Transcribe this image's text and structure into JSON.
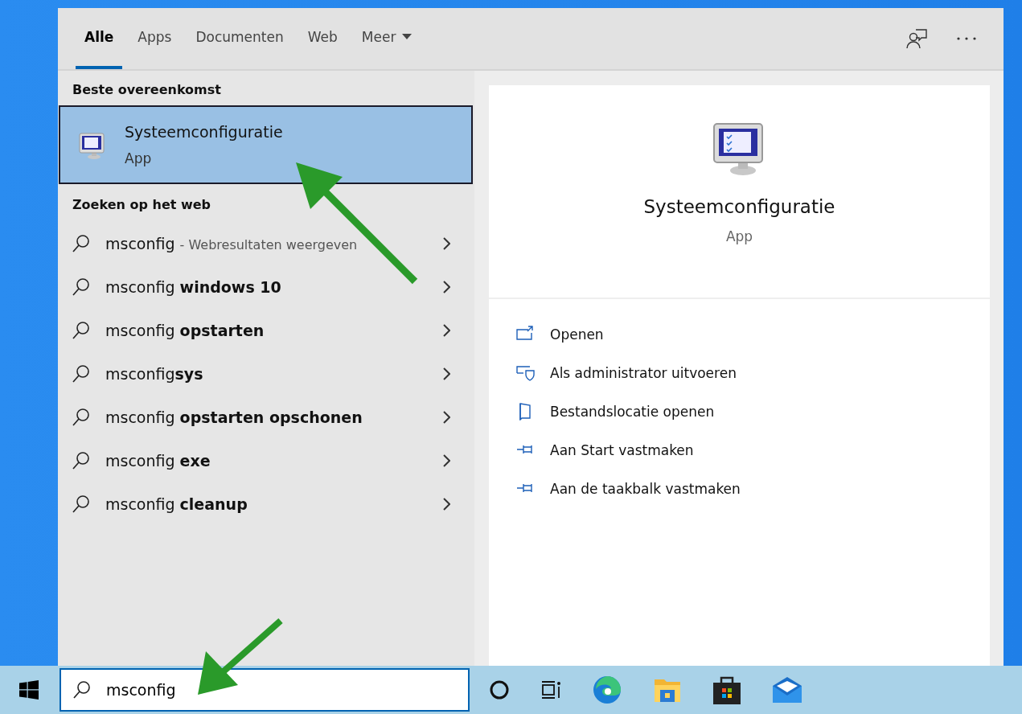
{
  "tabs": [
    {
      "label": "Alle",
      "selected": true
    },
    {
      "label": "Apps",
      "selected": false
    },
    {
      "label": "Documenten",
      "selected": false
    },
    {
      "label": "Web",
      "selected": false
    },
    {
      "label": "Meer",
      "selected": false,
      "dropdown": true
    }
  ],
  "best_match": {
    "heading": "Beste overeenkomst",
    "title": "Systeemconfiguratie",
    "subtitle": "App",
    "selected": true
  },
  "web_search": {
    "heading": "Zoeken op het web",
    "items": [
      {
        "text": "msconfig",
        "note": "- Webresultaten weergeven"
      },
      {
        "text": "msconfig **windows 10**"
      },
      {
        "text": "msconfig **opstarten**"
      },
      {
        "text": "msconfig**sys**"
      },
      {
        "text": "msconfig **opstarten opschonen**"
      },
      {
        "text": "msconfig **exe**"
      },
      {
        "text": "msconfig **cleanup**"
      }
    ]
  },
  "preview": {
    "title": "Systeemconfiguratie",
    "subtitle": "App",
    "actions": [
      {
        "kind": "open",
        "label": "Openen"
      },
      {
        "kind": "admin",
        "label": "Als administrator uitvoeren"
      },
      {
        "kind": "folder",
        "label": "Bestandslocatie openen"
      },
      {
        "kind": "pin",
        "label": "Aan Start vastmaken"
      },
      {
        "kind": "pin",
        "label": "Aan de taakbalk vastmaken"
      }
    ]
  },
  "search_box": {
    "value": "msconfig"
  }
}
